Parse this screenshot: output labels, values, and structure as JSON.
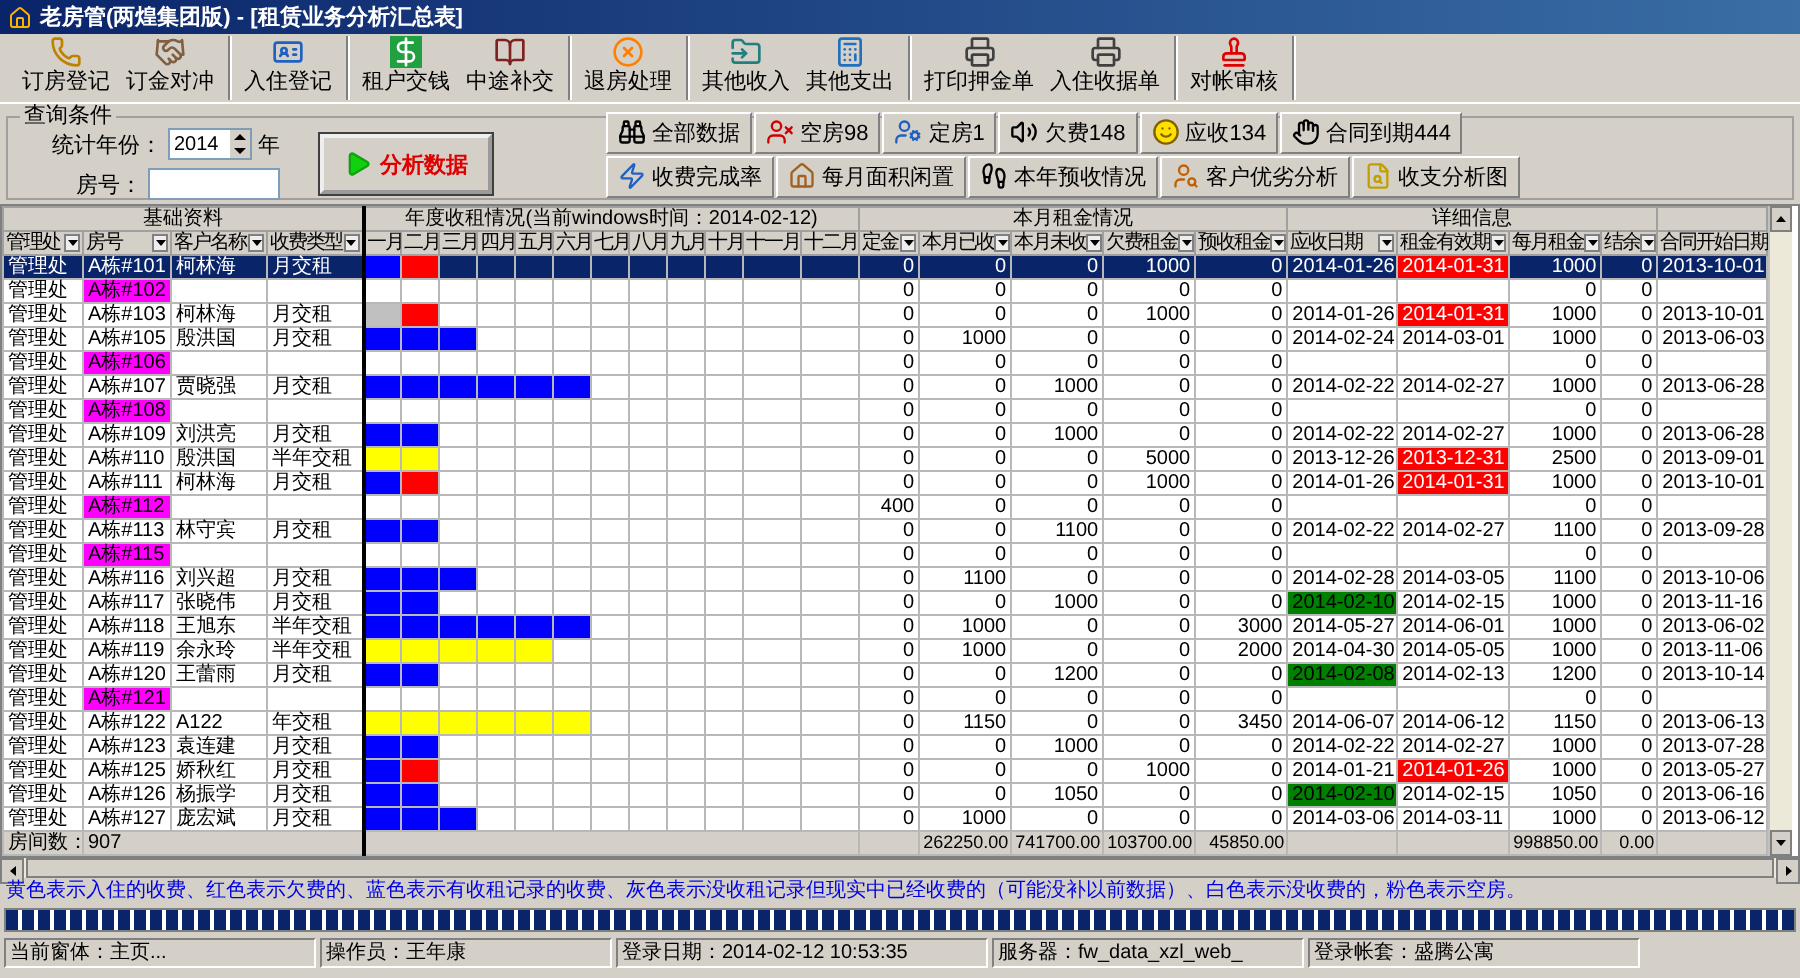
{
  "window": {
    "title": "老房管(两煌集团版) - [租赁业务分析汇总表]"
  },
  "toolbar": [
    [
      {
        "label": "订房登记"
      },
      {
        "label": "订金对冲"
      }
    ],
    [
      {
        "label": "入住登记"
      }
    ],
    [
      {
        "label": "租户交钱"
      },
      {
        "label": "中途补交"
      }
    ],
    [
      {
        "label": "退房处理"
      }
    ],
    [
      {
        "label": "其他收入"
      },
      {
        "label": "其他支出"
      }
    ],
    [
      {
        "label": "打印押金单"
      },
      {
        "label": "入住收据单"
      }
    ],
    [
      {
        "label": "对帐审核"
      }
    ]
  ],
  "query": {
    "title": "查询条件",
    "year_label": "统计年份：",
    "year": "2014",
    "year_unit": "年",
    "room_label": "房号：",
    "analyze_button": "分析数据",
    "shortcuts": [
      [
        {
          "label": "全部数据"
        },
        {
          "label": "空房98"
        },
        {
          "label": "定房1"
        },
        {
          "label": "欠费148"
        },
        {
          "label": "应收134"
        },
        {
          "label": "合同到期444"
        }
      ],
      [
        {
          "label": "收费完成率"
        },
        {
          "label": "每月面积闲置"
        },
        {
          "label": "本年预收情况"
        },
        {
          "label": "客户优劣分析"
        },
        {
          "label": "收支分析图"
        }
      ]
    ]
  },
  "table": {
    "groups": [
      "基础资料",
      "年度收租情况(当前windows时间：2014-02-12)",
      "本月租金情况",
      "详细信息"
    ],
    "columns": [
      "管理处",
      "房号",
      "客户名称",
      "收费类型",
      "定金",
      "本月已收",
      "本月未收",
      "欠费租金",
      "预收租金",
      "应收日期",
      "租金有效期",
      "每月租金",
      "结余",
      "合同开始日期"
    ],
    "months": [
      "一月",
      "二月",
      "三月",
      "四月",
      "五月",
      "六月",
      "七月",
      "八月",
      "九月",
      "十月",
      "十一月",
      "十二月"
    ],
    "rows": [
      {
        "office": "管理处",
        "room": "A栋#101",
        "customer": "柯林海",
        "fee_type": "月交租",
        "vacant": false,
        "selected": true,
        "months": [
          {
            "color": "#0000ff"
          },
          {
            "color": "#ff0000"
          }
        ],
        "values": [
          "0",
          "0",
          "0",
          "1000",
          "0"
        ],
        "due_date": "2014-01-26",
        "due_soon": false,
        "valid_until": "2014-01-31",
        "overdue": true,
        "monthly": "1000",
        "balance": "0",
        "start_date": "2013-10-01"
      },
      {
        "office": "管理处",
        "room": "A栋#102",
        "vacant": true,
        "selected": false,
        "values": [
          "0",
          "0",
          "0",
          "0",
          "0"
        ],
        "due_soon": false,
        "overdue": false,
        "monthly": "0",
        "balance": "0"
      },
      {
        "office": "管理处",
        "room": "A栋#103",
        "customer": "柯林海",
        "fee_type": "月交租",
        "vacant": false,
        "selected": false,
        "months": [
          {
            "color": "#c0c0c0"
          },
          {
            "color": "#ff0000"
          }
        ],
        "values": [
          "0",
          "0",
          "0",
          "1000",
          "0"
        ],
        "due_date": "2014-01-26",
        "due_soon": false,
        "valid_until": "2014-01-31",
        "overdue": true,
        "monthly": "1000",
        "balance": "0",
        "start_date": "2013-10-01"
      },
      {
        "office": "管理处",
        "room": "A栋#105",
        "customer": "殷洪国",
        "fee_type": "月交租",
        "vacant": false,
        "selected": false,
        "months": [
          {
            "color": "#0000ff"
          },
          {
            "color": "#0000ff"
          },
          {
            "color": "#0000ff"
          }
        ],
        "values": [
          "0",
          "1000",
          "0",
          "0",
          "0"
        ],
        "due_date": "2014-02-24",
        "due_soon": false,
        "valid_until": "2014-03-01",
        "overdue": false,
        "monthly": "1000",
        "balance": "0",
        "start_date": "2013-06-03"
      },
      {
        "office": "管理处",
        "room": "A栋#106",
        "vacant": true,
        "selected": false,
        "values": [
          "0",
          "0",
          "0",
          "0",
          "0"
        ],
        "due_soon": false,
        "overdue": false,
        "monthly": "0",
        "balance": "0"
      },
      {
        "office": "管理处",
        "room": "A栋#107",
        "customer": "贾晓强",
        "fee_type": "月交租",
        "vacant": false,
        "selected": false,
        "months": [
          {
            "color": "#0000ff"
          },
          {
            "color": "#0000ff"
          },
          {
            "color": "#0000ff"
          },
          {
            "color": "#0000ff"
          },
          {
            "color": "#0000ff"
          },
          {
            "color": "#0000ff"
          }
        ],
        "values": [
          "0",
          "0",
          "1000",
          "0",
          "0"
        ],
        "due_date": "2014-02-22",
        "due_soon": false,
        "valid_until": "2014-02-27",
        "overdue": false,
        "monthly": "1000",
        "balance": "0",
        "start_date": "2013-06-28"
      },
      {
        "office": "管理处",
        "room": "A栋#108",
        "vacant": true,
        "selected": false,
        "values": [
          "0",
          "0",
          "0",
          "0",
          "0"
        ],
        "due_soon": false,
        "overdue": false,
        "monthly": "0",
        "balance": "0"
      },
      {
        "office": "管理处",
        "room": "A栋#109",
        "customer": "刘洪亮",
        "fee_type": "月交租",
        "vacant": false,
        "selected": false,
        "months": [
          {
            "color": "#0000ff"
          },
          {
            "color": "#0000ff"
          }
        ],
        "values": [
          "0",
          "0",
          "1000",
          "0",
          "0"
        ],
        "due_date": "2014-02-22",
        "due_soon": false,
        "valid_until": "2014-02-27",
        "overdue": false,
        "monthly": "1000",
        "balance": "0",
        "start_date": "2013-06-28"
      },
      {
        "office": "管理处",
        "room": "A栋#110",
        "customer": "殷洪国",
        "fee_type": "半年交租",
        "vacant": false,
        "selected": false,
        "months": [
          {
            "color": "#ffff00"
          },
          {
            "color": "#ffff00"
          }
        ],
        "values": [
          "0",
          "0",
          "0",
          "5000",
          "0"
        ],
        "due_date": "2013-12-26",
        "due_soon": false,
        "valid_until": "2013-12-31",
        "overdue": true,
        "monthly": "2500",
        "balance": "0",
        "start_date": "2013-09-01"
      },
      {
        "office": "管理处",
        "room": "A栋#111",
        "customer": "柯林海",
        "fee_type": "月交租",
        "vacant": false,
        "selected": false,
        "months": [
          {
            "color": "#0000ff"
          },
          {
            "color": "#ff0000"
          }
        ],
        "values": [
          "0",
          "0",
          "0",
          "1000",
          "0"
        ],
        "due_date": "2014-01-26",
        "due_soon": false,
        "valid_until": "2014-01-31",
        "overdue": true,
        "monthly": "1000",
        "balance": "0",
        "start_date": "2013-10-01"
      },
      {
        "office": "管理处",
        "room": "A栋#112",
        "vacant": true,
        "selected": false,
        "values": [
          "400",
          "0",
          "0",
          "0",
          "0"
        ],
        "due_soon": false,
        "overdue": false,
        "monthly": "0",
        "balance": "0"
      },
      {
        "office": "管理处",
        "room": "A栋#113",
        "customer": "林守宾",
        "fee_type": "月交租",
        "vacant": false,
        "selected": false,
        "months": [
          {
            "color": "#0000ff"
          },
          {
            "color": "#0000ff"
          }
        ],
        "values": [
          "0",
          "0",
          "1100",
          "0",
          "0"
        ],
        "due_date": "2014-02-22",
        "due_soon": false,
        "valid_until": "2014-02-27",
        "overdue": false,
        "monthly": "1100",
        "balance": "0",
        "start_date": "2013-09-28"
      },
      {
        "office": "管理处",
        "room": "A栋#115",
        "vacant": true,
        "selected": false,
        "values": [
          "0",
          "0",
          "0",
          "0",
          "0"
        ],
        "due_soon": false,
        "overdue": false,
        "monthly": "0",
        "balance": "0"
      },
      {
        "office": "管理处",
        "room": "A栋#116",
        "customer": "刘兴超",
        "fee_type": "月交租",
        "vacant": false,
        "selected": false,
        "months": [
          {
            "color": "#0000ff"
          },
          {
            "color": "#0000ff"
          },
          {
            "color": "#0000ff"
          }
        ],
        "values": [
          "0",
          "1100",
          "0",
          "0",
          "0"
        ],
        "due_date": "2014-02-28",
        "due_soon": false,
        "valid_until": "2014-03-05",
        "overdue": false,
        "monthly": "1100",
        "balance": "0",
        "start_date": "2013-10-06"
      },
      {
        "office": "管理处",
        "room": "A栋#117",
        "customer": "张晓伟",
        "fee_type": "月交租",
        "vacant": false,
        "selected": false,
        "months": [
          {
            "color": "#0000ff"
          },
          {
            "color": "#0000ff"
          }
        ],
        "values": [
          "0",
          "0",
          "1000",
          "0",
          "0"
        ],
        "due_date": "2014-02-10",
        "due_soon": true,
        "valid_until": "2014-02-15",
        "overdue": false,
        "monthly": "1000",
        "balance": "0",
        "start_date": "2013-11-16"
      },
      {
        "office": "管理处",
        "room": "A栋#118",
        "customer": "王旭东",
        "fee_type": "半年交租",
        "vacant": false,
        "selected": false,
        "months": [
          {
            "color": "#0000ff"
          },
          {
            "color": "#0000ff"
          },
          {
            "color": "#0000ff"
          },
          {
            "color": "#0000ff"
          },
          {
            "color": "#0000ff"
          },
          {
            "color": "#0000ff"
          }
        ],
        "values": [
          "0",
          "1000",
          "0",
          "0",
          "3000"
        ],
        "due_date": "2014-05-27",
        "due_soon": false,
        "valid_until": "2014-06-01",
        "overdue": false,
        "monthly": "1000",
        "balance": "0",
        "start_date": "2013-06-02"
      },
      {
        "office": "管理处",
        "room": "A栋#119",
        "customer": "余永玲",
        "fee_type": "半年交租",
        "vacant": false,
        "selected": false,
        "months": [
          {
            "color": "#ffff00"
          },
          {
            "color": "#ffff00"
          },
          {
            "color": "#ffff00"
          },
          {
            "color": "#ffff00"
          },
          {
            "color": "#ffff00"
          }
        ],
        "values": [
          "0",
          "1000",
          "0",
          "0",
          "2000"
        ],
        "due_date": "2014-04-30",
        "due_soon": false,
        "valid_until": "2014-05-05",
        "overdue": false,
        "monthly": "1000",
        "balance": "0",
        "start_date": "2013-11-06"
      },
      {
        "office": "管理处",
        "room": "A栋#120",
        "customer": "王蕾雨",
        "fee_type": "月交租",
        "vacant": false,
        "selected": false,
        "months": [
          {
            "color": "#0000ff"
          },
          {
            "color": "#0000ff"
          }
        ],
        "values": [
          "0",
          "0",
          "1200",
          "0",
          "0"
        ],
        "due_date": "2014-02-08",
        "due_soon": true,
        "valid_until": "2014-02-13",
        "overdue": false,
        "monthly": "1200",
        "balance": "0",
        "start_date": "2013-10-14"
      },
      {
        "office": "管理处",
        "room": "A栋#121",
        "vacant": true,
        "selected": false,
        "values": [
          "0",
          "0",
          "0",
          "0",
          "0"
        ],
        "due_soon": false,
        "overdue": false,
        "monthly": "0",
        "balance": "0"
      },
      {
        "office": "管理处",
        "room": "A栋#122",
        "customer": "A122",
        "fee_type": "年交租",
        "vacant": false,
        "selected": false,
        "months": [
          {
            "color": "#ffff00"
          },
          {
            "color": "#ffff00"
          },
          {
            "color": "#ffff00"
          },
          {
            "color": "#ffff00"
          },
          {
            "color": "#ffff00"
          },
          {
            "color": "#ffff00"
          }
        ],
        "values": [
          "0",
          "1150",
          "0",
          "0",
          "3450"
        ],
        "due_date": "2014-06-07",
        "due_soon": false,
        "valid_until": "2014-06-12",
        "overdue": false,
        "monthly": "1150",
        "balance": "0",
        "start_date": "2013-06-13"
      },
      {
        "office": "管理处",
        "room": "A栋#123",
        "customer": "袁连建",
        "fee_type": "月交租",
        "vacant": false,
        "selected": false,
        "months": [
          {
            "color": "#0000ff"
          },
          {
            "color": "#0000ff"
          }
        ],
        "values": [
          "0",
          "0",
          "1000",
          "0",
          "0"
        ],
        "due_date": "2014-02-22",
        "due_soon": false,
        "valid_until": "2014-02-27",
        "overdue": false,
        "monthly": "1000",
        "balance": "0",
        "start_date": "2013-07-28"
      },
      {
        "office": "管理处",
        "room": "A栋#125",
        "customer": "娇秋红",
        "fee_type": "月交租",
        "vacant": false,
        "selected": false,
        "months": [
          {
            "color": "#0000ff"
          },
          {
            "color": "#ff0000"
          }
        ],
        "values": [
          "0",
          "0",
          "0",
          "1000",
          "0"
        ],
        "due_date": "2014-01-21",
        "due_soon": false,
        "valid_until": "2014-01-26",
        "overdue": true,
        "monthly": "1000",
        "balance": "0",
        "start_date": "2013-05-27"
      },
      {
        "office": "管理处",
        "room": "A栋#126",
        "customer": "杨振学",
        "fee_type": "月交租",
        "vacant": false,
        "selected": false,
        "months": [
          {
            "color": "#0000ff"
          },
          {
            "color": "#0000ff"
          }
        ],
        "values": [
          "0",
          "0",
          "1050",
          "0",
          "0"
        ],
        "due_date": "2014-02-10",
        "due_soon": true,
        "valid_until": "2014-02-15",
        "overdue": false,
        "monthly": "1050",
        "balance": "0",
        "start_date": "2013-06-16"
      },
      {
        "office": "管理处",
        "room": "A栋#127",
        "customer": "庞宏斌",
        "fee_type": "月交租",
        "vacant": false,
        "selected": false,
        "months": [
          {
            "color": "#0000ff"
          },
          {
            "color": "#0000ff"
          },
          {
            "color": "#0000ff"
          }
        ],
        "values": [
          "0",
          "1000",
          "0",
          "0",
          "0"
        ],
        "due_date": "2014-03-06",
        "due_soon": false,
        "valid_until": "2014-03-11",
        "overdue": false,
        "monthly": "1000",
        "balance": "0",
        "start_date": "2013-06-12"
      }
    ],
    "totals": {
      "label": "房间数：",
      "count": "907",
      "cells": [
        null,
        "262250.00",
        "741700.00",
        "103700.00",
        "45850.00",
        null,
        null,
        "998850.00",
        "0.00",
        null
      ]
    }
  },
  "legend": "黄色表示入住的收费、红色表示欠费的、蓝色表示有收租记录的收费、灰色表示没收租记录但现实中已经收费的（可能没补以前数据）、白色表示没收费的，粉色表示空房。",
  "progress": {
    "level": 1
  },
  "status_bar": [
    {
      "label": "当前窗体：",
      "value": "主页..."
    },
    {
      "label": "操作员：",
      "value": "王年康"
    },
    {
      "label": "登录日期：",
      "value": "2014-02-12 10:53:35"
    },
    {
      "label": "服务器：",
      "value": "fw_data_xzl_web_"
    },
    {
      "label": "登录帐套：",
      "value": "盛腾公寓"
    }
  ]
}
